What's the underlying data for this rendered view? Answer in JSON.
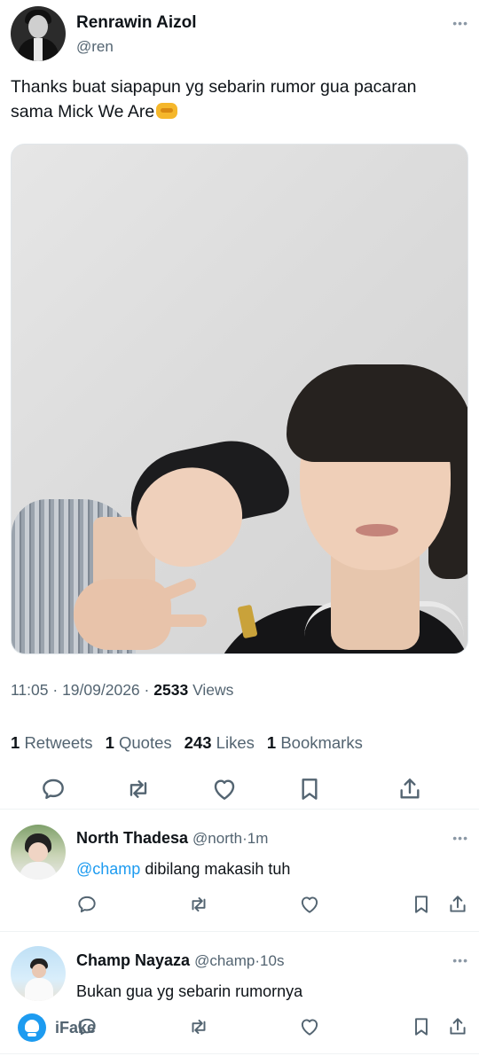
{
  "tweet": {
    "author_name": "Renrawin Aizol",
    "author_handle": "@ren",
    "more_label": "•••",
    "text": "Thanks buat siapapun yg sebarin rumor gua pacaran sama Mick We Are",
    "time": "11:05",
    "date": "19/09/2026",
    "separator": "·",
    "views_count": "2533",
    "views_label": "Views",
    "stats": {
      "retweets_count": "1",
      "retweets_label": "Retweets",
      "quotes_count": "1",
      "quotes_label": "Quotes",
      "likes_count": "243",
      "likes_label": "Likes",
      "bookmarks_count": "1",
      "bookmarks_label": "Bookmarks"
    },
    "actions": [
      "reply-icon",
      "retweet-icon",
      "like-icon",
      "bookmark-icon",
      "share-icon"
    ]
  },
  "replies": [
    {
      "name": "North Thadesa",
      "handle": "@north",
      "time": "1m",
      "mention": "@champ",
      "text": "dibilang makasih tuh"
    },
    {
      "name": "Champ Nayaza",
      "handle": "@champ",
      "time": "10s",
      "mention": "",
      "text": "Bukan gua yg sebarin rumornya"
    }
  ],
  "watermark": {
    "text": "iFake"
  },
  "colors": {
    "accent": "#1d9bf0",
    "text": "#0f1419",
    "secondary": "#536471",
    "icon": "#536471",
    "divider": "#eff3f4"
  }
}
